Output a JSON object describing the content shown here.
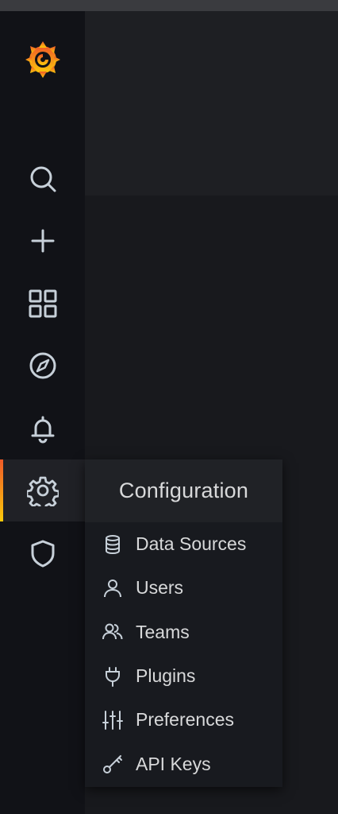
{
  "colors": {
    "sidebar_bg": "#111217",
    "icon": "#c7d0d9",
    "menu_text": "#d8d9da",
    "active_accent_top": "#f05a28",
    "active_accent_bottom": "#fbca0a"
  },
  "sidebar": {
    "logo": "grafana-logo",
    "items": [
      {
        "id": "search",
        "icon": "search-icon"
      },
      {
        "id": "create",
        "icon": "plus-icon"
      },
      {
        "id": "dashboards",
        "icon": "apps-icon"
      },
      {
        "id": "explore",
        "icon": "compass-icon"
      },
      {
        "id": "alerting",
        "icon": "bell-icon"
      },
      {
        "id": "configuration",
        "icon": "gear-icon",
        "active": true
      },
      {
        "id": "server-admin",
        "icon": "shield-icon"
      }
    ]
  },
  "config_menu": {
    "title": "Configuration",
    "items": [
      {
        "label": "Data Sources",
        "icon": "database-icon"
      },
      {
        "label": "Users",
        "icon": "user-icon"
      },
      {
        "label": "Teams",
        "icon": "users-icon"
      },
      {
        "label": "Plugins",
        "icon": "plug-icon"
      },
      {
        "label": "Preferences",
        "icon": "sliders-icon"
      },
      {
        "label": "API Keys",
        "icon": "key-icon"
      }
    ]
  }
}
